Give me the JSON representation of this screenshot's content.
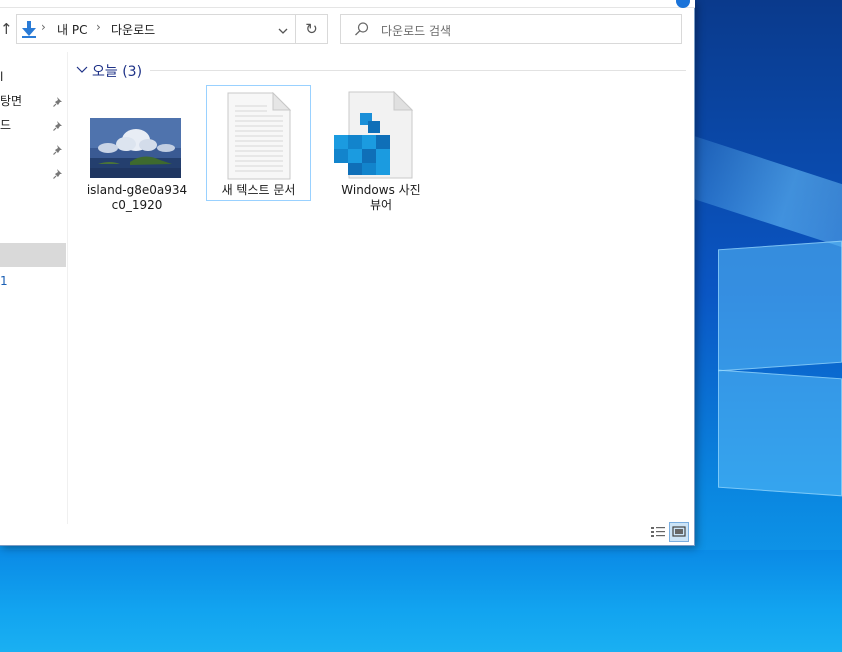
{
  "address": {
    "crumbs": [
      "내 PC",
      "다운로드"
    ],
    "separator": "›"
  },
  "search": {
    "placeholder": "다운로드 검색"
  },
  "nav": {
    "items": [
      {
        "label": "l",
        "pinned": false
      },
      {
        "label": "탕면",
        "pinned": true
      },
      {
        "label": "드",
        "pinned": true
      },
      {
        "label": "",
        "pinned": true
      },
      {
        "label": "",
        "pinned": true
      }
    ],
    "link_label": "1"
  },
  "group": {
    "label": "오늘 (3)"
  },
  "files": [
    {
      "name": "island-g8e0a934c0_1920",
      "line1": "island-g8e0a934",
      "line2": "c0_1920",
      "type": "image"
    },
    {
      "name": "새 텍스트 문서",
      "line1": "새 텍스트 문서",
      "line2": "",
      "type": "text-document"
    },
    {
      "name": "Windows 사진 뷰어",
      "line1": "Windows 사진",
      "line2": "뷰어",
      "type": "registry-file"
    }
  ],
  "view": {
    "active": "large-icons"
  },
  "colors": {
    "accent": "#1a73d9",
    "group_header": "#1e3287",
    "selection_border": "#99d1ff"
  }
}
